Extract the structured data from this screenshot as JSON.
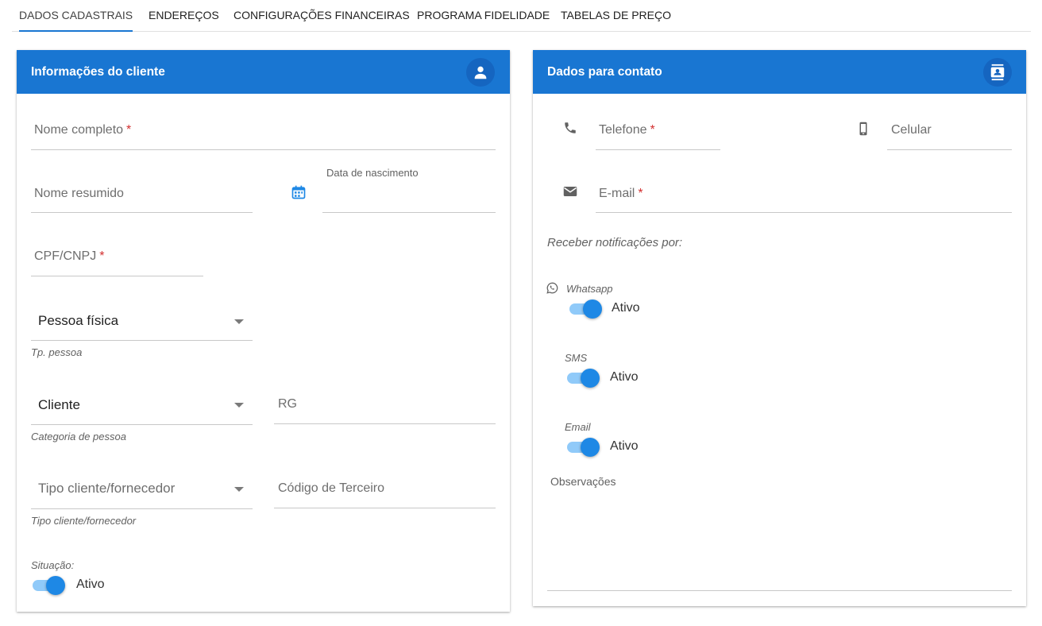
{
  "tabs": [
    {
      "label": "DADOS CADASTRAIS",
      "active": true
    },
    {
      "label": "ENDEREÇOS"
    },
    {
      "label": "CONFIGURAÇÕES FINANCEIRAS"
    },
    {
      "label": "PROGRAMA FIDELIDADE"
    },
    {
      "label": "TABELAS DE PREÇO"
    }
  ],
  "colors": {
    "primary": "#1976d2",
    "required": "#d32f2f",
    "toggle_on": "#1e88e5"
  },
  "client_card": {
    "title": "Informações do cliente",
    "header_icon": "person-icon",
    "nome_completo": {
      "label": "Nome completo",
      "required_mark": "*"
    },
    "nome_resumido": {
      "label": "Nome resumido"
    },
    "data_nascimento": {
      "label": "Data de nascimento",
      "icon": "calendar-icon"
    },
    "cpf_cnpj": {
      "label": "CPF/CNPJ",
      "required_mark": "*"
    },
    "tp_pessoa": {
      "value": "Pessoa física",
      "hint": "Tp. pessoa"
    },
    "categoria": {
      "value": "Cliente",
      "hint": "Categoria de pessoa"
    },
    "rg": {
      "label": "RG"
    },
    "tipo_cliente": {
      "placeholder": "Tipo cliente/fornecedor",
      "hint": "Tipo cliente/fornecedor"
    },
    "codigo_terceiro": {
      "label": "Código de Terceiro"
    },
    "situacao": {
      "label": "Situação:",
      "state": "Ativo",
      "on": true
    }
  },
  "contact_card": {
    "title": "Dados para contato",
    "header_icon": "contact-card-icon",
    "telefone": {
      "label": "Telefone",
      "required_mark": "*",
      "icon": "phone-icon"
    },
    "celular": {
      "label": "Celular",
      "icon": "mobile-phone-icon"
    },
    "email": {
      "label": "E-mail",
      "required_mark": "*",
      "icon": "email-icon"
    },
    "notifications_title": "Receber notificações por:",
    "whatsapp": {
      "label": "Whatsapp",
      "state": "Ativo",
      "on": true,
      "icon": "whatsapp-icon"
    },
    "sms": {
      "label": "SMS",
      "state": "Ativo",
      "on": true
    },
    "email_notif": {
      "label": "Email",
      "state": "Ativo",
      "on": true
    },
    "observacoes": {
      "label": "Observações"
    }
  }
}
